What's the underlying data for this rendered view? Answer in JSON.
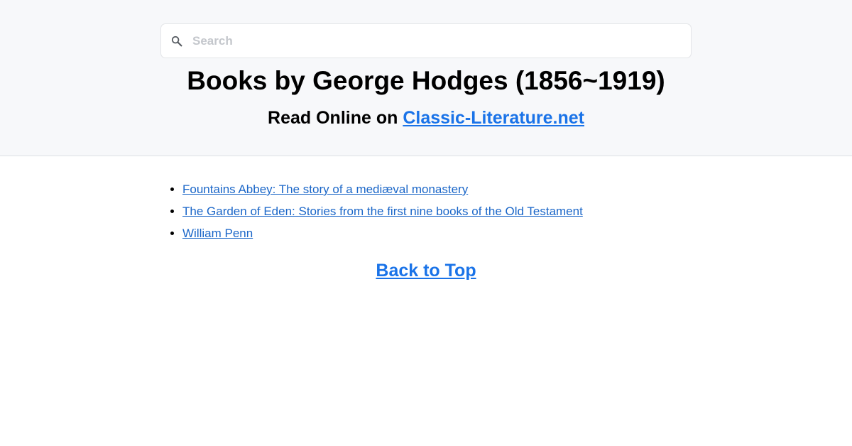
{
  "search": {
    "placeholder": "Search",
    "value": ""
  },
  "header": {
    "title": "Books by George Hodges (1856~1919)",
    "subtitle_prefix": "Read Online on ",
    "site_link": "Classic-Literature.net"
  },
  "books": [
    "Fountains Abbey: The story of a mediæval monastery",
    "The Garden of Eden: Stories from the first nine books of the Old Testament",
    "William Penn"
  ],
  "footer": {
    "back_to_top": "Back to Top"
  },
  "colors": {
    "link": "#1a73e8",
    "header_bg": "#f7f8fa"
  },
  "icons": {
    "search": "search-icon"
  }
}
